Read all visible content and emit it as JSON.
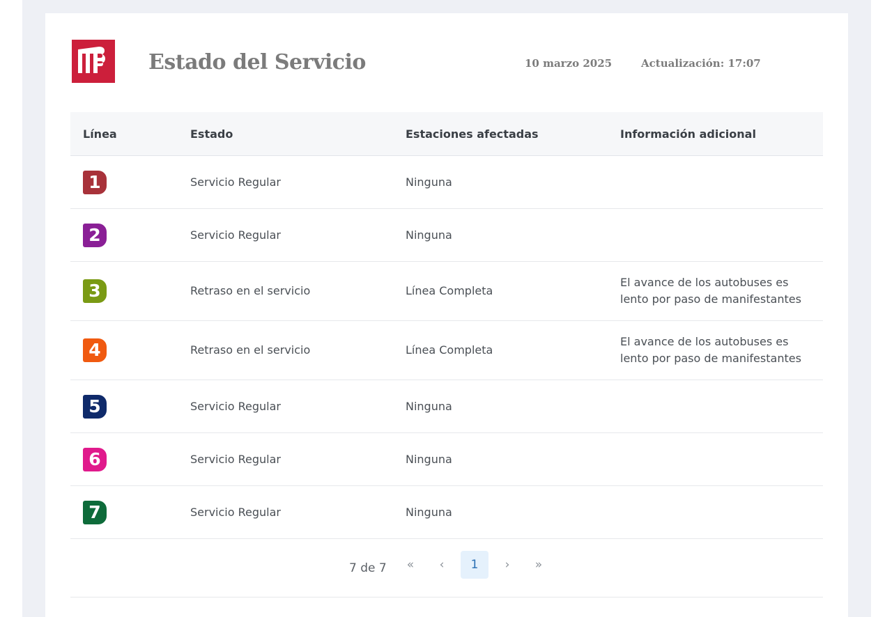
{
  "header": {
    "title": "Estado del Servicio",
    "date": "10 marzo 2025",
    "update": "Actualización: 17:07",
    "logo_text": "MB"
  },
  "table": {
    "columns": [
      "Línea",
      "Estado",
      "Estaciones afectadas",
      "Información adicional"
    ],
    "rows": [
      {
        "line": "1",
        "color": "#a8323a",
        "status": "Servicio Regular",
        "stations": "Ninguna",
        "info": ""
      },
      {
        "line": "2",
        "color": "#8a1f96",
        "status": "Servicio Regular",
        "stations": "Ninguna",
        "info": ""
      },
      {
        "line": "3",
        "color": "#7a9a14",
        "status": "Retraso en el servicio",
        "stations": "Línea Completa",
        "info": "El avance de los autobuses es lento por paso de manifestantes"
      },
      {
        "line": "4",
        "color": "#f05a10",
        "status": "Retraso en el servicio",
        "stations": "Línea Completa",
        "info": "El avance de los autobuses es lento por paso de manifestantes"
      },
      {
        "line": "5",
        "color": "#0f2a6a",
        "status": "Servicio Regular",
        "stations": "Ninguna",
        "info": ""
      },
      {
        "line": "6",
        "color": "#e01a8c",
        "status": "Servicio Regular",
        "stations": "Ninguna",
        "info": ""
      },
      {
        "line": "7",
        "color": "#0e6b3a",
        "status": "Servicio Regular",
        "stations": "Ninguna",
        "info": ""
      }
    ]
  },
  "pagination": {
    "count": "7 de 7",
    "first": "«",
    "prev": "‹",
    "current": "1",
    "next": "›",
    "last": "»"
  },
  "colors": {
    "brand": "#cc1f3b",
    "header_text": "#7b7b7b"
  }
}
